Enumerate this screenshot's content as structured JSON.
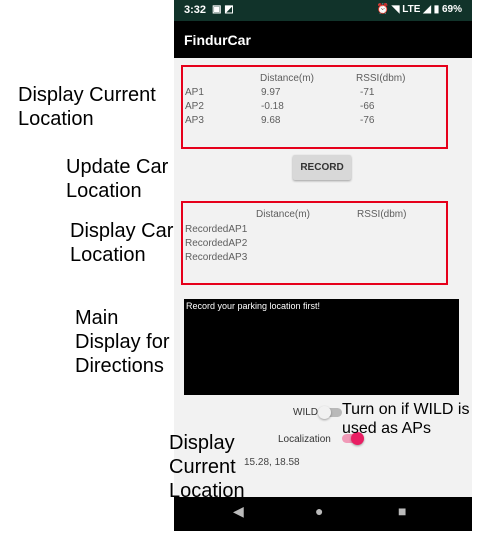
{
  "status_bar": {
    "time": "3:32",
    "network": "LTE",
    "battery": "69%"
  },
  "app": {
    "title": "FindurCar"
  },
  "current_location": {
    "headers": [
      "Distance(m)",
      "RSSI(dbm)"
    ],
    "rows": [
      {
        "ap": "AP1",
        "distance": "9.97",
        "rssi": "-71"
      },
      {
        "ap": "AP2",
        "distance": "-0.18",
        "rssi": "-66"
      },
      {
        "ap": "AP3",
        "distance": "9.68",
        "rssi": "-76"
      }
    ]
  },
  "record_button": {
    "label": "RECORD"
  },
  "car_location": {
    "headers": [
      "Distance(m)",
      "RSSI(dbm)"
    ],
    "rows": [
      {
        "ap": "RecordedAP1"
      },
      {
        "ap": "RecordedAP2"
      },
      {
        "ap": "RecordedAP3"
      }
    ]
  },
  "directions": {
    "text": "Record your parking location first!"
  },
  "toggles": {
    "wild": {
      "label": "WILD",
      "on": false
    },
    "localization": {
      "label": "Localization",
      "on": true
    }
  },
  "coordinates": {
    "value": "15.28, 18.58"
  },
  "annotations": {
    "display_current_location": [
      "Display Current",
      "Location"
    ],
    "update_car_location": [
      "Update Car",
      "Location"
    ],
    "display_car_location": [
      "Display Car",
      "Location"
    ],
    "main_display": [
      "Main",
      "Display for",
      "Directions"
    ],
    "wild_note": [
      "Turn on if WILD is",
      "used as APs"
    ],
    "display_current_location_bottom": [
      "Display",
      "Current",
      "Location"
    ]
  },
  "colors": {
    "highlight_box": "#e6001b",
    "toggle_accent": "#e91e63",
    "app_bar": "#000000",
    "status_bar": "#11332a"
  }
}
